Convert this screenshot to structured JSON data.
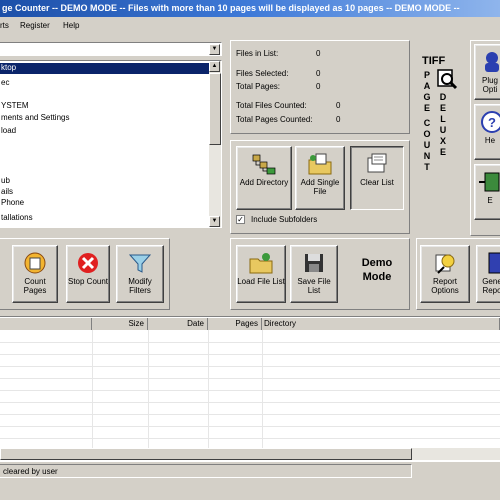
{
  "title": "ge Counter -- DEMO MODE -- Files with more than 10 pages will be displayed as 10 pages -- DEMO MODE --",
  "menu": [
    "rts",
    "Register",
    "Help"
  ],
  "folder_tree": [
    "ktop",
    "ec",
    "YSTEM",
    "ments and Settings",
    "load",
    "",
    "ub",
    "ails",
    "Phone",
    "",
    "tallations"
  ],
  "stats": {
    "files_in_list_label": "Files in List:",
    "files_in_list_value": "0",
    "files_selected_label": "Files Selected:",
    "files_selected_value": "0",
    "total_pages_label": "Total Pages:",
    "total_pages_value": "0",
    "total_files_counted_label": "Total Files Counted:",
    "total_files_counted_value": "0",
    "total_pages_counted_label": "Total Pages Counted:",
    "total_pages_counted_value": "0"
  },
  "buttons": {
    "add_directory": "Add Directory",
    "add_single_file": "Add Single File",
    "clear_list": "Clear List",
    "include_subfolders": "Include Subfolders",
    "count_pages": "Count Pages",
    "stop_count": "Stop Count",
    "modify_filters": "Modify Filters",
    "load_file_list": "Load File List",
    "save_file_list": "Save File List",
    "report_options": "Report Options",
    "generate_report": "Gene Repo",
    "plugin_options": "Plug Opti",
    "help": "He",
    "exit": "E"
  },
  "logo": {
    "top": "TIFF",
    "left_vertical": "PAGE COUNT",
    "right_vertical": "DELUXE"
  },
  "demo_mode": "Demo Mode",
  "table": {
    "columns": [
      "",
      "Size",
      "Date",
      "Pages",
      "Directory"
    ]
  },
  "status": "cleared by user",
  "colors": {
    "title_start": "#1c4fa8",
    "title_end": "#8fb5ec",
    "selection": "#0a246a",
    "face": "#d4d0c8"
  }
}
